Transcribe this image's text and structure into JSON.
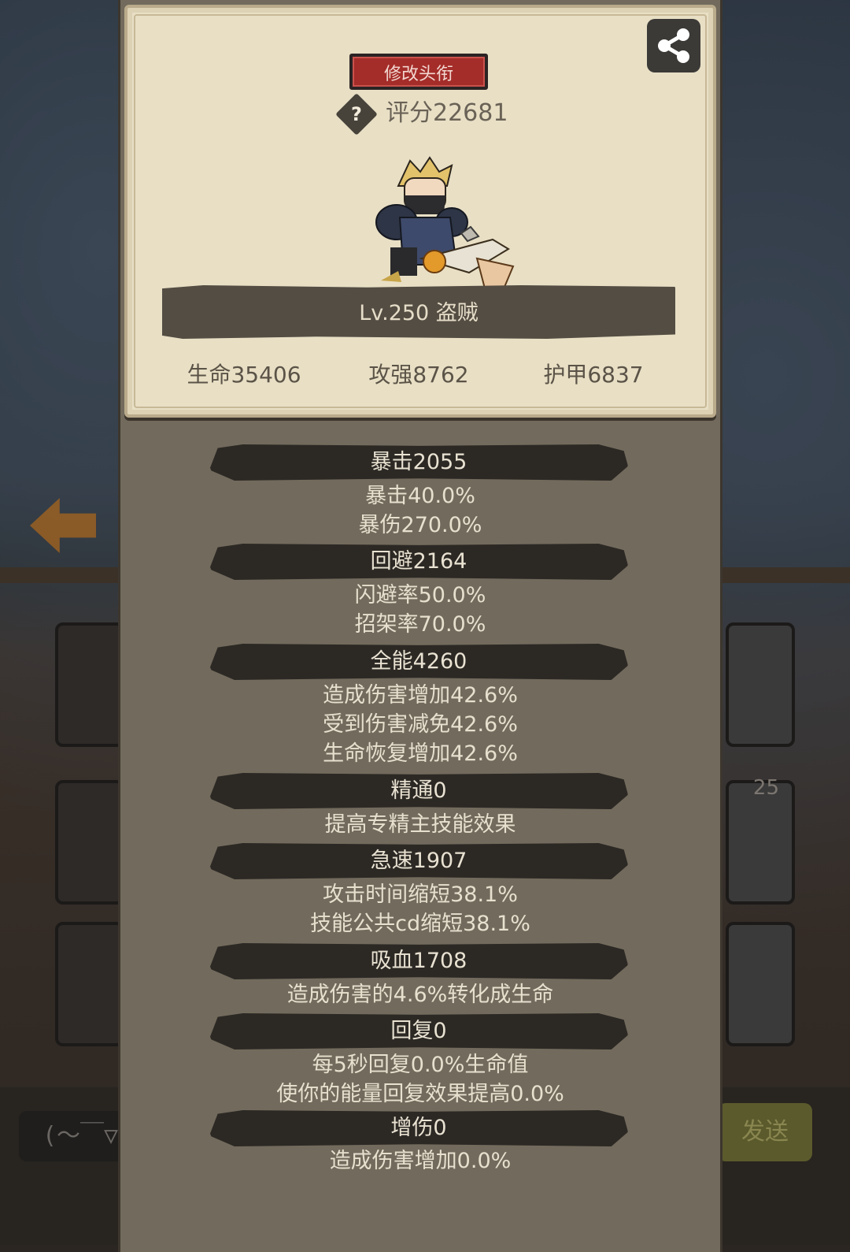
{
  "header": {
    "title_button": "修改头衔",
    "help_icon": "question-diamond-icon",
    "score": "评分22681",
    "share_icon": "share-icon"
  },
  "hero": {
    "level_class": "Lv.250 盗贼"
  },
  "main_stats": {
    "hp": "生命35406",
    "attack": "攻强8762",
    "armor": "护甲6837"
  },
  "attributes": [
    {
      "name": "暴击2055",
      "details": [
        "暴击40.0%",
        "暴伤270.0%"
      ]
    },
    {
      "name": "回避2164",
      "details": [
        "闪避率50.0%",
        "招架率70.0%"
      ]
    },
    {
      "name": "全能4260",
      "details": [
        "造成伤害增加42.6%",
        "受到伤害减免42.6%",
        "生命恢复增加42.6%"
      ]
    },
    {
      "name": "精通0",
      "details": [
        "提高专精主技能效果"
      ]
    },
    {
      "name": "急速1907",
      "details": [
        "攻击时间缩短38.1%",
        "技能公共cd缩短38.1%"
      ]
    },
    {
      "name": "吸血1708",
      "details": [
        "造成伤害的4.6%转化成生命"
      ]
    },
    {
      "name": "回复0",
      "details": [
        "每5秒回复0.0%生命值",
        "使你的能量回复效果提高0.0%"
      ]
    },
    {
      "name": "增伤0",
      "details": [
        "造成伤害增加0.0%"
      ]
    }
  ],
  "background": {
    "emote_text": "(～￣▽",
    "send_text": "发送",
    "badge_count": "25"
  },
  "colors": {
    "panel": "#726a5c",
    "card": "#e8dfc5",
    "title_button": "#a42c29",
    "attr_bar": "#2c2925"
  }
}
